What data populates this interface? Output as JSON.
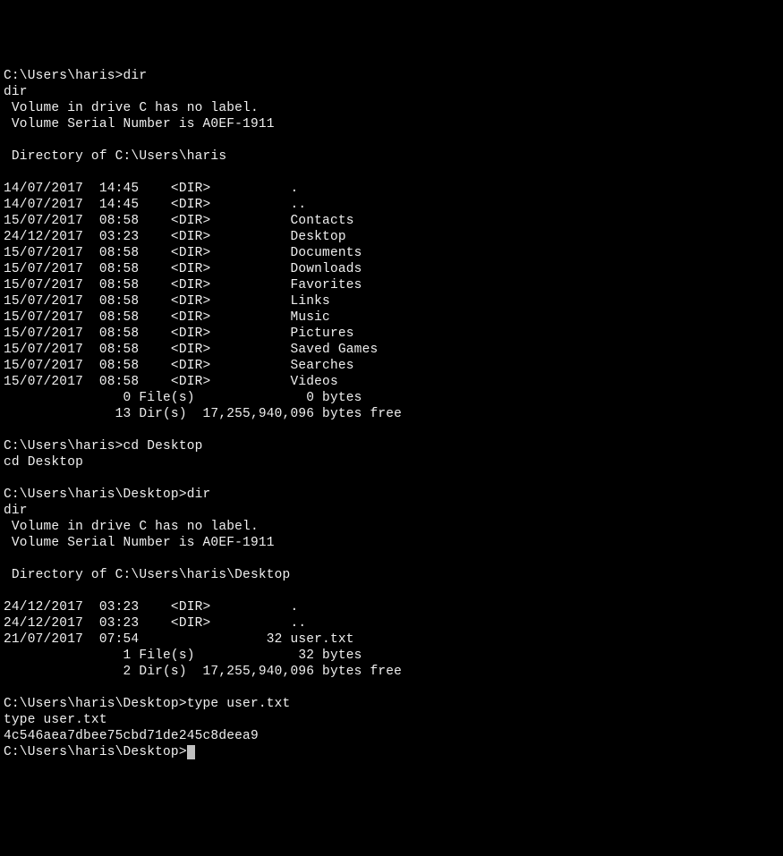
{
  "block1": {
    "prompt": "C:\\Users\\haris>dir",
    "echo": "dir",
    "volume": " Volume in drive C has no label.",
    "serial": " Volume Serial Number is A0EF-1911",
    "dirOf": " Directory of C:\\Users\\haris",
    "entries": [
      "14/07/2017  14:45    <DIR>          .",
      "14/07/2017  14:45    <DIR>          ..",
      "15/07/2017  08:58    <DIR>          Contacts",
      "24/12/2017  03:23    <DIR>          Desktop",
      "15/07/2017  08:58    <DIR>          Documents",
      "15/07/2017  08:58    <DIR>          Downloads",
      "15/07/2017  08:58    <DIR>          Favorites",
      "15/07/2017  08:58    <DIR>          Links",
      "15/07/2017  08:58    <DIR>          Music",
      "15/07/2017  08:58    <DIR>          Pictures",
      "15/07/2017  08:58    <DIR>          Saved Games",
      "15/07/2017  08:58    <DIR>          Searches",
      "15/07/2017  08:58    <DIR>          Videos"
    ],
    "fileSummary": "               0 File(s)              0 bytes",
    "dirSummary": "              13 Dir(s)  17,255,940,096 bytes free"
  },
  "block2": {
    "prompt": "C:\\Users\\haris>cd Desktop",
    "echo": "cd Desktop"
  },
  "block3": {
    "prompt": "C:\\Users\\haris\\Desktop>dir",
    "echo": "dir",
    "volume": " Volume in drive C has no label.",
    "serial": " Volume Serial Number is A0EF-1911",
    "dirOf": " Directory of C:\\Users\\haris\\Desktop",
    "entries": [
      "24/12/2017  03:23    <DIR>          .",
      "24/12/2017  03:23    <DIR>          ..",
      "21/07/2017  07:54                32 user.txt"
    ],
    "fileSummary": "               1 File(s)             32 bytes",
    "dirSummary": "               2 Dir(s)  17,255,940,096 bytes free"
  },
  "block4": {
    "prompt": "C:\\Users\\haris\\Desktop>type user.txt",
    "echo": "type user.txt",
    "output": "4c546aea7dbee75cbd71de245c8deea9",
    "finalPrompt": "C:\\Users\\haris\\Desktop>"
  }
}
